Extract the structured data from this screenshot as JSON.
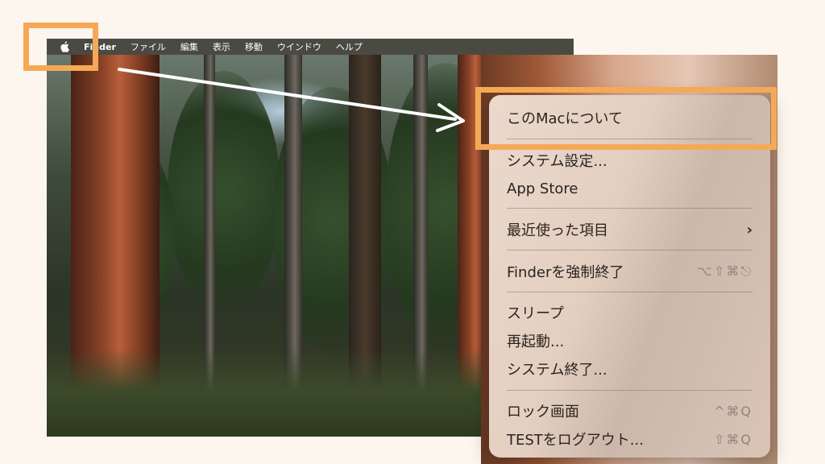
{
  "menubar": {
    "apple_icon": "apple-logo-icon",
    "items": [
      "Finder",
      "ファイル",
      "編集",
      "表示",
      "移動",
      "ウインドウ",
      "ヘルプ"
    ]
  },
  "apple_menu": {
    "about": "このMacについて",
    "settings": "システム設定...",
    "app_store": "App Store",
    "recent_items": "最近使った項目",
    "recent_chevron": "›",
    "force_quit": "Finderを強制終了",
    "force_quit_shortcut": "⌥⇧⌘⎋",
    "sleep": "スリープ",
    "restart": "再起動...",
    "shutdown": "システム終了...",
    "lock_screen": "ロック画面",
    "lock_shortcut": "^⌘Q",
    "logout": "TESTをログアウト...",
    "logout_shortcut": "⇧⌘Q"
  },
  "colors": {
    "highlight": "#f5a957",
    "menubar": "#4a4a42"
  }
}
